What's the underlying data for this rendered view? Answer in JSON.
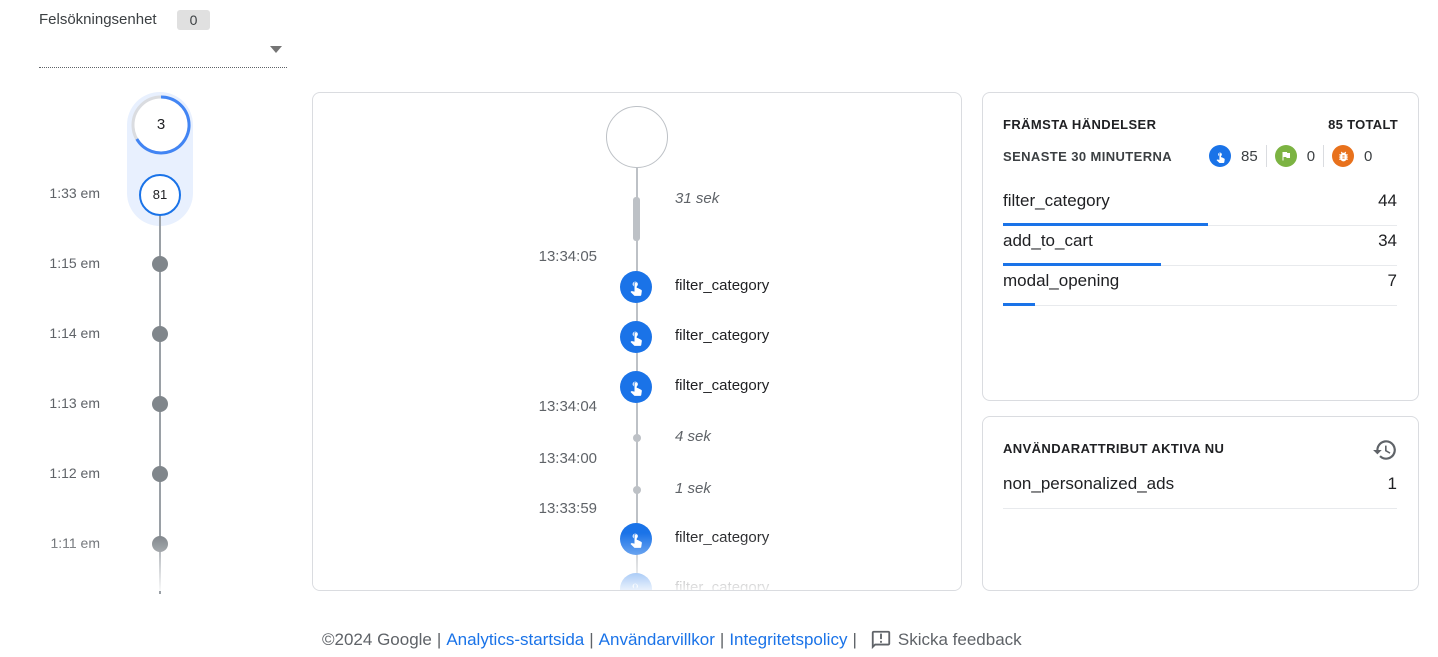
{
  "device": {
    "label": "Felsökningsenhet",
    "count": "0"
  },
  "minutes": {
    "current": "3",
    "active": {
      "time": "1:33 em",
      "value": "81"
    },
    "rows": [
      {
        "time": "1:15 em"
      },
      {
        "time": "1:14 em"
      },
      {
        "time": "1:13 em"
      },
      {
        "time": "1:12 em"
      },
      {
        "time": "1:11 em"
      }
    ]
  },
  "stream": {
    "gap1": "31 sek",
    "time1": "13:34:05",
    "events": [
      "filter_category",
      "filter_category",
      "filter_category",
      "filter_category",
      "filter_category"
    ],
    "time2": "13:34:04",
    "gap2": "4 sek",
    "time3": "13:34:00",
    "gap3": "1 sek",
    "time4": "13:33:59"
  },
  "top_events": {
    "title": "FRÄMSTA HÄNDELSER",
    "total": "85 TOTALT",
    "subtitle": "SENASTE 30 MINUTERNA",
    "counters": {
      "events": "85",
      "conversions": "0",
      "errors": "0"
    },
    "rows": [
      {
        "name": "filter_category",
        "value": "44",
        "share": 0.52
      },
      {
        "name": "add_to_cart",
        "value": "34",
        "share": 0.4
      },
      {
        "name": "modal_opening",
        "value": "7",
        "share": 0.08
      }
    ]
  },
  "user_attributes": {
    "title": "ANVÄNDARATTRIBUT AKTIVA NU",
    "rows": [
      {
        "name": "non_personalized_ads",
        "value": "1"
      }
    ]
  },
  "footer": {
    "copyright": "©2024 Google",
    "links": [
      "Analytics-startsida",
      "Användarvillkor",
      "Integritetspolicy"
    ],
    "feedback": "Skicka feedback"
  },
  "colors": {
    "accent": "#1a73e8",
    "conversion": "#7cb342",
    "error": "#e8711c"
  }
}
